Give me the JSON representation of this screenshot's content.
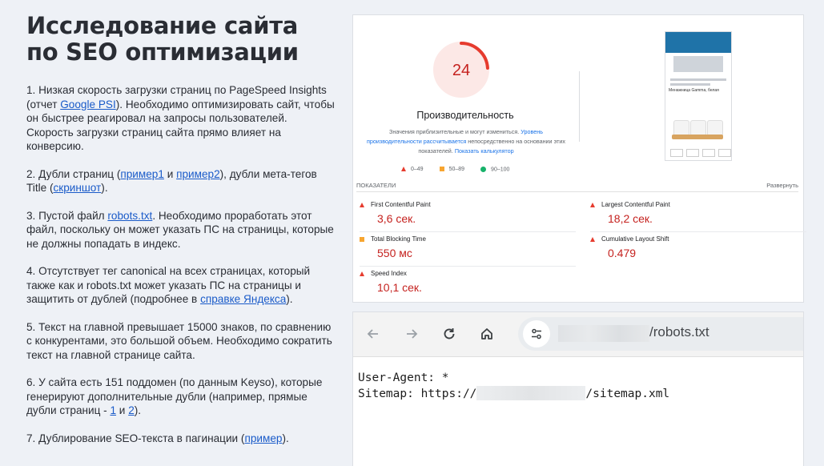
{
  "heading": {
    "line1": "Исследование сайта",
    "line2": "по SEO оптимизации"
  },
  "items": {
    "i1": {
      "pre": "1. Низкая скорость загрузки страниц по PageSpeed Insights (отчет ",
      "link": "Google PSI",
      "post": "). Необходимо оптимизировать сайт, чтобы он быстрее реагировал на запросы пользователей. Скорость загрузки страниц сайта прямо влияет на конверсию."
    },
    "i2": {
      "pre": "2. Дубли страниц (",
      "link1": "пример1",
      "mid1": " и ",
      "link2": "пример2",
      "mid2": "), дубли мета-тегов Title (",
      "link3": "скриншот",
      "post": ")."
    },
    "i3": {
      "pre": "3. Пустой файл ",
      "link": "robots.txt",
      "post": ". Необходимо проработать этот файл, поскольку он может указать ПС на страницы, которые не должны попадать в индекс."
    },
    "i4": {
      "pre": "4. Отсутствует тег canonical на всех страницах, который также как и robots.txt может указать ПС на страницы и защитить от дублей (подробнее в ",
      "link": "справке Яндекса",
      "post": ")."
    },
    "i5": {
      "text": "5. Текст на главной превышает 15000 знаков, по сравнению с конкурентами, это большой объем. Необходимо сократить текст на главной странице сайта."
    },
    "i6": {
      "pre": "6. У сайта есть 151 поддомен (по данным Keyso), которые генерируют дополнительные дубли (например, прямые дубли страниц - ",
      "link1": "1",
      "mid": " и ",
      "link2": "2",
      "post": ")."
    },
    "i7": {
      "pre": "7. Дублирование SEO-текста в пагинации (",
      "link": "пример",
      "post": ")."
    }
  },
  "psi": {
    "score": "24",
    "score_value": 24,
    "perf_title": "Производительность",
    "note_pre": "Значения приблизительные и могут измениться. ",
    "note_link1": "Уровень производительности рассчитывается",
    "note_mid": " непосредственно на основании этих показателей. ",
    "note_link2": "Показать калькулятор",
    "legend": [
      "0–49",
      "50–89",
      "90–100"
    ],
    "section_label": "ПОКАЗАТЕЛИ",
    "expand": "Развернуть",
    "phone_caption": "Менажница Gamma, белая",
    "metrics": [
      {
        "label": "First Contentful Paint",
        "value": "3,6 сек.",
        "status": "red"
      },
      {
        "label": "Largest Contentful Paint",
        "value": "18,2 сек.",
        "status": "red"
      },
      {
        "label": "Total Blocking Time",
        "value": "550 мс",
        "status": "orange"
      },
      {
        "label": "Cumulative Layout Shift",
        "value": "0.479",
        "status": "red"
      },
      {
        "label": "Speed Index",
        "value": "10,1 сек.",
        "status": "red"
      }
    ],
    "colors": {
      "bad": "#e63b2e",
      "average": "#f7a530",
      "good": "#17b26a"
    }
  },
  "browser": {
    "url_suffix": "/robots.txt",
    "line1": "User-Agent: *",
    "line2_pre": "Sitemap: https://",
    "line2_post": "/sitemap.xml"
  }
}
